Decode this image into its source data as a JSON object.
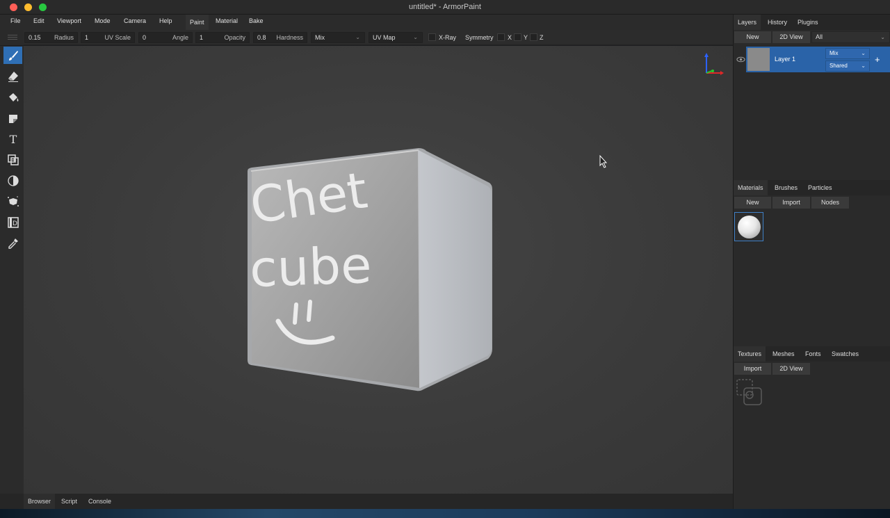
{
  "window": {
    "title": "untitled* - ArmorPaint"
  },
  "menu": {
    "items": [
      "File",
      "Edit",
      "Viewport",
      "Mode",
      "Camera",
      "Help"
    ],
    "modes": [
      "Paint",
      "Material",
      "Bake"
    ],
    "active_mode": "Paint"
  },
  "toolbar": {
    "radius": {
      "value": "0.15",
      "label": "Radius"
    },
    "uv_scale": {
      "value": "1",
      "label": "UV Scale"
    },
    "angle": {
      "value": "0",
      "label": "Angle"
    },
    "opacity": {
      "value": "1",
      "label": "Opacity"
    },
    "hardness": {
      "value": "0.8",
      "label": "Hardness"
    },
    "blend": {
      "value": "Mix"
    },
    "texcoord": {
      "value": "UV Map"
    },
    "xray_label": "X-Ray",
    "symmetry_label": "Symmetry",
    "axes": [
      "X",
      "Y",
      "Z"
    ]
  },
  "tools": [
    "brush-icon",
    "eraser-icon",
    "fill-icon",
    "decal-icon",
    "text-icon",
    "clone-icon",
    "blur-icon",
    "particle-icon",
    "bake-icon",
    "picker-icon"
  ],
  "viewport": {
    "painted_text": [
      "Chet",
      "cube"
    ]
  },
  "bottom_tabs": [
    "Browser",
    "Script",
    "Console"
  ],
  "layers_panel": {
    "tabs": [
      "Layers",
      "History",
      "Plugins"
    ],
    "buttons": {
      "new": "New",
      "view2d": "2D View"
    },
    "filter": "All",
    "layer": {
      "name": "Layer 1",
      "blend": "Mix",
      "object": "Shared",
      "add": "+"
    }
  },
  "materials_panel": {
    "tabs": [
      "Materials",
      "Brushes",
      "Particles"
    ],
    "buttons": {
      "new": "New",
      "import": "Import",
      "nodes": "Nodes"
    }
  },
  "textures_panel": {
    "tabs": [
      "Textures",
      "Meshes",
      "Fonts",
      "Swatches"
    ],
    "buttons": {
      "import": "Import",
      "view2d": "2D View"
    }
  },
  "colors": {
    "accent": "#2a63a8",
    "panel": "#2a2a2a",
    "viewport": "#3d3d3d"
  }
}
